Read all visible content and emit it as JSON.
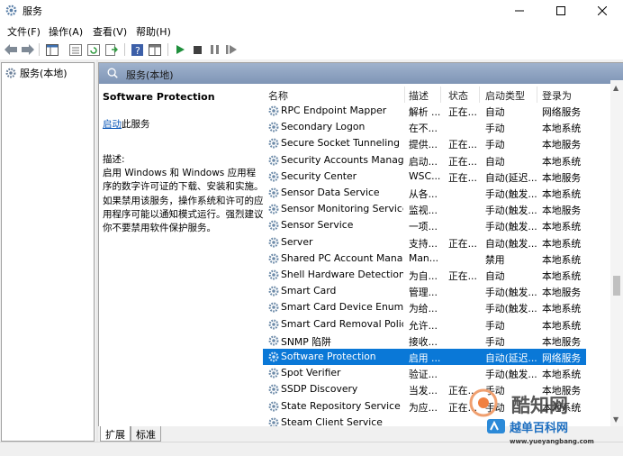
{
  "window": {
    "title": "服务",
    "icon": "gear-icon",
    "controls": [
      "minimize",
      "maximize",
      "close"
    ]
  },
  "menu": [
    {
      "label": "文件(F)"
    },
    {
      "label": "操作(A)"
    },
    {
      "label": "查看(V)"
    },
    {
      "label": "帮助(H)"
    }
  ],
  "toolbar": {
    "buttons": [
      "back-icon",
      "forward-icon",
      "show-tree-icon",
      "properties-icon",
      "refresh-icon",
      "export-icon",
      "help-icon",
      "console-icon",
      "play-icon",
      "stop-icon",
      "pause-icon",
      "restart-icon"
    ]
  },
  "tree": {
    "label": "服务(本地)"
  },
  "pane_header": {
    "title": "服务(本地)"
  },
  "description": {
    "service_name": "Software Protection",
    "start_link": "启动",
    "start_suffix": "此服务",
    "label": "描述:",
    "body": "启用 Windows 和 Windows 应用程序的数字许可证的下载、安装和实施。如果禁用该服务，操作系统和许可的应用程序可能以通知模式运行。强烈建议你不要禁用软件保护服务。"
  },
  "columns": {
    "name": "名称",
    "desc": "描述",
    "status": "状态",
    "startup": "启动类型",
    "logon": "登录为"
  },
  "services": [
    {
      "name": "RPC Endpoint Mapper",
      "desc": "解析 ...",
      "status": "正在...",
      "startup": "自动",
      "logon": "网络服务"
    },
    {
      "name": "Secondary Logon",
      "desc": "在不...",
      "status": "",
      "startup": "手动",
      "logon": "本地系统"
    },
    {
      "name": "Secure Socket Tunneling P...",
      "desc": "提供...",
      "status": "正在...",
      "startup": "手动",
      "logon": "本地服务"
    },
    {
      "name": "Security Accounts Manager",
      "desc": "启动...",
      "status": "正在...",
      "startup": "自动",
      "logon": "本地系统"
    },
    {
      "name": "Security Center",
      "desc": "WSC...",
      "status": "正在...",
      "startup": "自动(延迟...",
      "logon": "本地服务"
    },
    {
      "name": "Sensor Data Service",
      "desc": "从各...",
      "status": "",
      "startup": "手动(触发...",
      "logon": "本地系统"
    },
    {
      "name": "Sensor Monitoring Service",
      "desc": "监视...",
      "status": "",
      "startup": "手动(触发...",
      "logon": "本地服务"
    },
    {
      "name": "Sensor Service",
      "desc": "一项...",
      "status": "",
      "startup": "手动(触发...",
      "logon": "本地系统"
    },
    {
      "name": "Server",
      "desc": "支持...",
      "status": "正在...",
      "startup": "自动(触发...",
      "logon": "本地系统"
    },
    {
      "name": "Shared PC Account Manager",
      "desc": "Man...",
      "status": "",
      "startup": "禁用",
      "logon": "本地系统"
    },
    {
      "name": "Shell Hardware Detection",
      "desc": "为自...",
      "status": "正在...",
      "startup": "自动",
      "logon": "本地系统"
    },
    {
      "name": "Smart Card",
      "desc": "管理...",
      "status": "",
      "startup": "手动(触发...",
      "logon": "本地服务"
    },
    {
      "name": "Smart Card Device Enumer...",
      "desc": "为给...",
      "status": "",
      "startup": "手动(触发...",
      "logon": "本地系统"
    },
    {
      "name": "Smart Card Removal Policy",
      "desc": "允许...",
      "status": "",
      "startup": "手动",
      "logon": "本地系统"
    },
    {
      "name": "SNMP 陷阱",
      "desc": "接收...",
      "status": "",
      "startup": "手动",
      "logon": "本地服务"
    },
    {
      "name": "Software Protection",
      "desc": "启用 ...",
      "status": "",
      "startup": "自动(延迟...",
      "logon": "网络服务",
      "selected": true
    },
    {
      "name": "Spot Verifier",
      "desc": "验证...",
      "status": "",
      "startup": "手动(触发...",
      "logon": "本地系统"
    },
    {
      "name": "SSDP Discovery",
      "desc": "当发...",
      "status": "正在...",
      "startup": "手动",
      "logon": "本地服务"
    },
    {
      "name": "State Repository Service",
      "desc": "为应...",
      "status": "正在...",
      "startup": "手动",
      "logon": "本地系统"
    },
    {
      "name": "Steam Client Service",
      "desc": "",
      "status": "",
      "startup": "",
      "logon": ""
    }
  ],
  "tabs": [
    {
      "label": "扩展"
    },
    {
      "label": "标准"
    }
  ],
  "watermark": {
    "brand": "酷知网",
    "site_name": "越单百科网",
    "url": "www.yueyangbang.com"
  },
  "colors": {
    "selection": "#0a78d7",
    "header": "#8aa0bf",
    "link": "#0b57b8"
  }
}
